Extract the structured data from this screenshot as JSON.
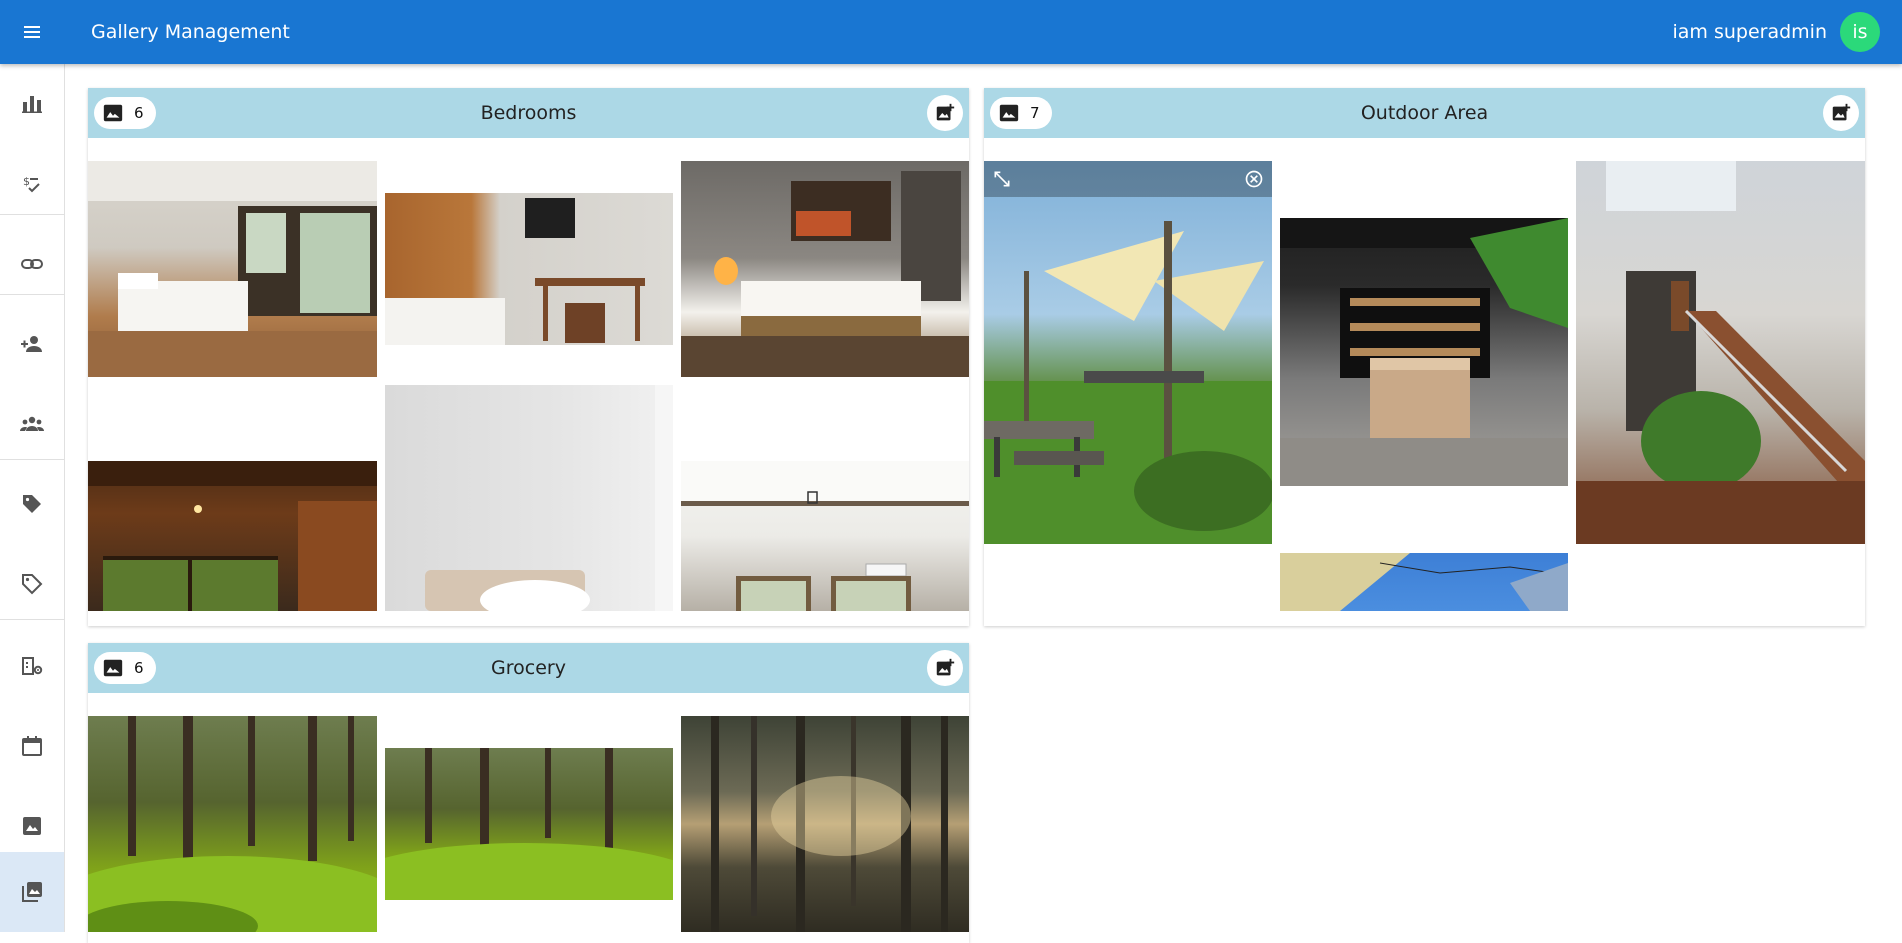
{
  "app": {
    "title": "Gallery Management",
    "user_name": "iam superadmin",
    "avatar_initials": "is",
    "avatar_color": "#2bd97a",
    "primary_color": "#1976d2",
    "header_color": "#acd8e6"
  },
  "sidebar": {
    "items": [
      {
        "icon": "bar-chart-icon",
        "active": false
      },
      {
        "icon": "checklist-icon",
        "active": false
      },
      {
        "icon": "link-icon",
        "active": false
      },
      {
        "icon": "add-person-icon",
        "active": false
      },
      {
        "icon": "group-icon",
        "active": false
      },
      {
        "icon": "tag-icon",
        "active": false
      },
      {
        "icon": "tag-outline-icon",
        "active": false
      },
      {
        "icon": "building-gear-icon",
        "active": false
      },
      {
        "icon": "calendar-icon",
        "active": false
      },
      {
        "icon": "image-icon",
        "active": false
      },
      {
        "icon": "photo-library-icon",
        "active": true
      }
    ]
  },
  "galleries": [
    {
      "title": "Bedrooms",
      "count": "6"
    },
    {
      "title": "Outdoor Area",
      "count": "7"
    },
    {
      "title": "Grocery",
      "count": "6"
    }
  ]
}
